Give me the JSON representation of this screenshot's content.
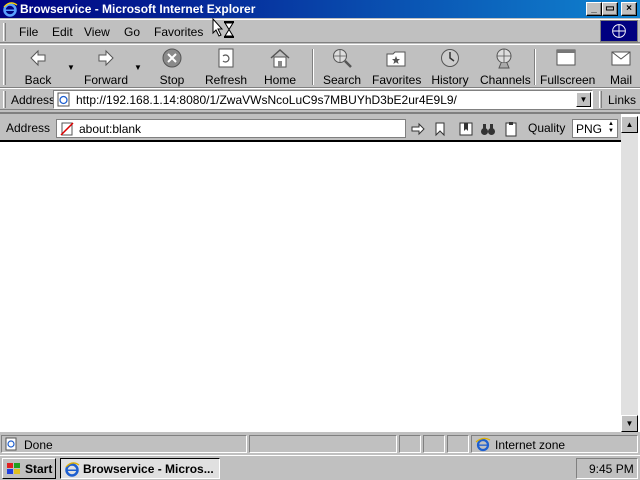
{
  "window": {
    "title": "Browservice - Microsoft Internet Explorer",
    "minimize_glyph": "_",
    "maximize_glyph": "▭",
    "close_glyph": "×"
  },
  "menu": {
    "items": [
      {
        "label": "File"
      },
      {
        "label": "Edit"
      },
      {
        "label": "View"
      },
      {
        "label": "Go"
      },
      {
        "label": "Favorites"
      }
    ]
  },
  "toolbar": {
    "buttons": [
      {
        "label": "Back",
        "icon": "back-arrow-icon"
      },
      {
        "label": "Forward",
        "icon": "forward-arrow-icon"
      },
      {
        "label": "Stop",
        "icon": "stop-icon"
      },
      {
        "label": "Refresh",
        "icon": "refresh-icon"
      },
      {
        "label": "Home",
        "icon": "home-icon"
      },
      {
        "label": "Search",
        "icon": "search-globe-icon"
      },
      {
        "label": "Favorites",
        "icon": "favorites-folder-icon"
      },
      {
        "label": "History",
        "icon": "history-icon"
      },
      {
        "label": "Channels",
        "icon": "channels-icon"
      },
      {
        "label": "Fullscreen",
        "icon": "fullscreen-icon"
      },
      {
        "label": "Mail",
        "icon": "mail-icon"
      }
    ]
  },
  "address_bar": {
    "label": "Address",
    "url": "http://192.168.1.14:8080/1/ZwaVWsNcoLuC9s7MBUYhD3bE2ur4E9L9/",
    "links_label": "Links"
  },
  "inner_bar": {
    "label": "Address",
    "value": "about:blank",
    "quality_label": "Quality",
    "quality_value": "PNG"
  },
  "status_bar": {
    "status_text": "Done",
    "zone_text": "Internet zone"
  },
  "taskbar": {
    "start_label": "Start",
    "task_label": "Browservice - Micros...",
    "clock": "9:45 PM"
  },
  "colors": {
    "titlebar_start": "#000080",
    "titlebar_end": "#1084d0",
    "face": "#c0c0c0",
    "desktop": "#008080"
  }
}
